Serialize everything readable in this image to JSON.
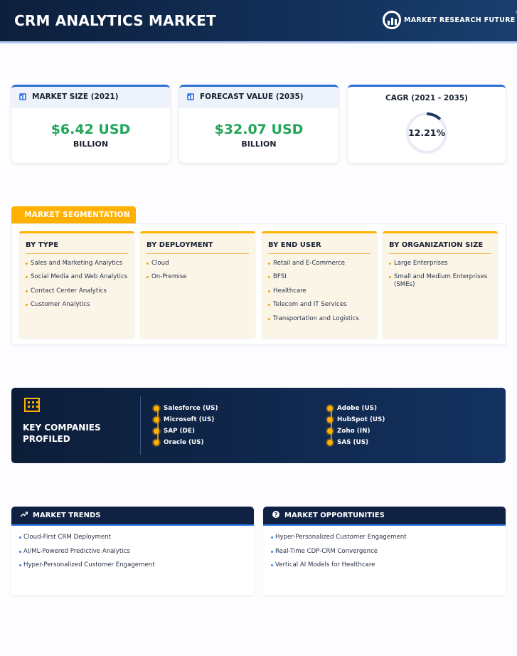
{
  "header": {
    "title": "CRM ANALYTICS MARKET",
    "logo_text": "MARKET RESEARCH FUTURE",
    "logo_reg": "®"
  },
  "stats": {
    "market_size": {
      "label": "MARKET SIZE (2021)",
      "value": "$6.42 USD",
      "unit": "BILLION",
      "icon": "bar-chart-icon"
    },
    "forecast": {
      "label": "FORECAST VALUE (2035)",
      "value": "$32.07 USD",
      "unit": "BILLION",
      "icon": "bar-chart-icon"
    },
    "cagr": {
      "label": "CAGR (2021 - 2035)",
      "value": "12.21%",
      "fraction": 0.1221
    }
  },
  "segmentation": {
    "title": "MARKET SEGMENTATION",
    "columns": [
      {
        "title": "BY TYPE",
        "items": [
          "Sales and Marketing Analytics",
          "Social Media and Web Analytics",
          "Contact Center Analytics",
          "Customer Analytics"
        ]
      },
      {
        "title": "BY DEPLOYMENT",
        "items": [
          "Cloud",
          "On-Premise"
        ]
      },
      {
        "title": "BY END USER",
        "items": [
          "Retail and E-Commerce",
          "BFSI",
          "Healthcare",
          "Telecom and IT Services",
          "Transportation and Logistics"
        ]
      },
      {
        "title": "BY ORGANIZATION SIZE",
        "items": [
          "Large Enterprises",
          "Small and Medium Enterprises (SMEs)"
        ]
      }
    ]
  },
  "companies": {
    "title": "KEY COMPANIES PROFILED",
    "left": [
      "Salesforce (US)",
      "Microsoft (US)",
      "SAP (DE)",
      "Oracle (US)"
    ],
    "right": [
      "Adobe (US)",
      "HubSpot (US)",
      "Zoho (IN)",
      "SAS (US)"
    ]
  },
  "trends": {
    "title": "MARKET TRENDS",
    "icon": "trend-up-icon",
    "items": [
      "Cloud-First CRM Deployment",
      "AI/ML-Powered Predictive Analytics",
      "Hyper-Personalized Customer Engagement"
    ]
  },
  "opportunities": {
    "title": "MARKET OPPORTUNITIES",
    "icon": "question-circle-icon",
    "items": [
      "Hyper-Personalized Customer Engagement",
      "Real-Time CDP-CRM Convergence",
      "Vertical AI Models for Healthcare"
    ]
  },
  "colors": {
    "navy": "#0f2244",
    "accent_blue": "#2f6fd4",
    "accent_orange": "#ffb000",
    "value_green": "#22a65a"
  }
}
